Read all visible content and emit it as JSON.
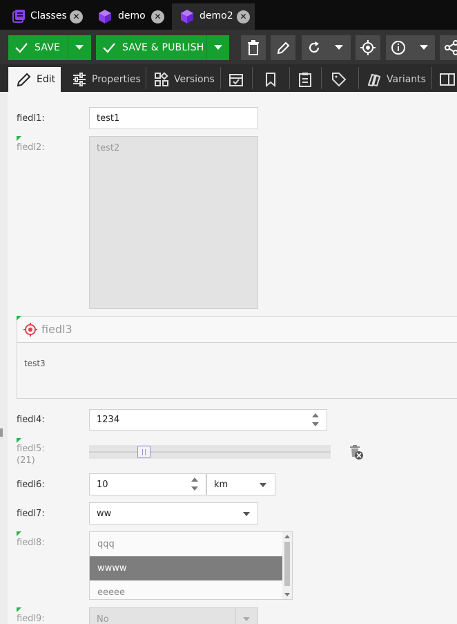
{
  "tabs": [
    {
      "label": "Classes",
      "icon": "classes-icon"
    },
    {
      "label": "demo",
      "icon": "object-cube-icon"
    },
    {
      "label": "demo2",
      "icon": "object-cube-icon",
      "active": true
    }
  ],
  "toolbar": {
    "save_label": "SAVE",
    "save_publish_label": "SAVE & PUBLISH",
    "icons": [
      "delete-icon",
      "rename-icon",
      "reload-icon",
      "locate-icon",
      "info-icon",
      "share-icon"
    ]
  },
  "subtabs": [
    {
      "label": "Edit",
      "icon": "pencil-icon",
      "active": true
    },
    {
      "label": "Properties",
      "icon": "sliders-icon"
    },
    {
      "label": "Versions",
      "icon": "versions-icon"
    },
    {
      "label": "",
      "icon": "schedule-icon"
    },
    {
      "label": "",
      "icon": "bookmark-icon"
    },
    {
      "label": "",
      "icon": "tasks-icon"
    },
    {
      "label": "",
      "icon": "tag-icon"
    },
    {
      "label": "Variants",
      "icon": "variants-icon"
    },
    {
      "label": "",
      "icon": "preview-icon"
    }
  ],
  "form": {
    "f1": {
      "label": "fiedl1:",
      "value": "test1"
    },
    "f2": {
      "label": "fiedl2:",
      "value": "test2"
    },
    "f3": {
      "title": "fiedl3",
      "value": "test3"
    },
    "f4": {
      "label": "fiedl4:",
      "value": "1234"
    },
    "f5": {
      "label": "fiedl5:",
      "sub": "(21)",
      "value": 21
    },
    "f6": {
      "label": "fiedl6:",
      "value": "10",
      "unit": "km"
    },
    "f7": {
      "label": "fiedl7:",
      "value": "ww"
    },
    "f8": {
      "label": "fiedl8:",
      "options": [
        "qqq",
        "wwww",
        "eeeee"
      ],
      "selected": "wwww"
    },
    "f9": {
      "label": "fiedl9:",
      "value": "No"
    }
  },
  "colors": {
    "green": "#16a02f",
    "accent_purple": "#7b3ff2",
    "target_red": "#e0434c"
  }
}
